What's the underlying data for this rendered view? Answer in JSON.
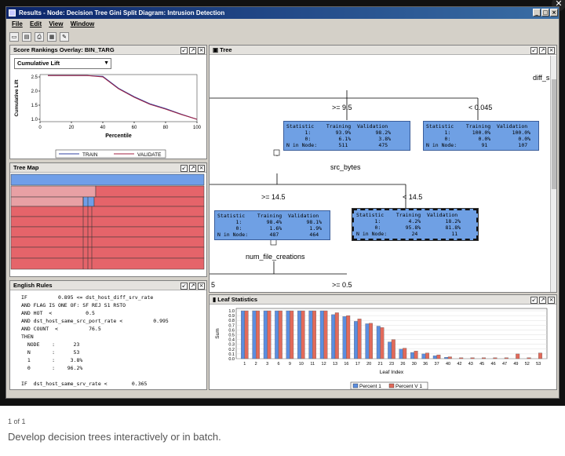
{
  "window": {
    "title": "Results - Node: Decision Tree Gini Split  Diagram: Intrusion Detection",
    "controls": [
      "_",
      "□",
      "×"
    ]
  },
  "menu": [
    "File",
    "Edit",
    "View",
    "Window"
  ],
  "score_panel": {
    "title": "Score Rankings Overlay: BIN_TARG",
    "dropdown": "Cumulative Lift",
    "legend_train": "TRAIN",
    "legend_validate": "VALIDATE"
  },
  "treemap_panel": {
    "title": "Tree Map"
  },
  "rules_panel": {
    "title": "English Rules",
    "text": "IF          0.895 <= dst_host_diff_srv_rate\nAND FLAG IS ONE OF: SF REJ S1 RSTO\nAND HOT  <           0.5\nAND dst_host_same_src_port_rate <          0.995\nAND COUNT  <          76.5\nTHEN\n  NODE    :      23\n  N       :      53\n  1       :     3.8%\n  0       :    96.2%\n\nIF  dst_host_same_srv_rate <        0.365"
  },
  "tree_panel": {
    "title": "Tree",
    "labels": {
      "diff": "diff_s",
      "ge95": ">=   9.5",
      "lt045": "<  0.045",
      "src": "src_bytes",
      "ge145": ">=  14.5",
      "lt145": "<   14.5",
      "num": "num_file_creations",
      "five": "5",
      "ge05": ">=   0.5"
    },
    "nodes": [
      "Statistic    Training  Validation\n      1:        93.9%        98.2%\n      0:         6.1%         3.8%\nN in Node:       511          475",
      "Statistic    Training  Validation\n      1:       100.0%       100.0%\n      0:         0.0%         0.0%\nN in Node:        91          107",
      "Statistic    Training  Validation\n      1:        98.4%        98.1%\n      0:         1.6%         1.9%\nN in Node:       487          464",
      "Statistic    Training  Validation\n      1:         4.2%        18.2%\n      0:        95.8%        81.8%\nN in Node:        24           11"
    ]
  },
  "leaf_panel": {
    "title": "Leaf Statistics"
  },
  "colors": {
    "title_bar": "#0a246a",
    "node_fill": "#6fa0e4",
    "bar_percent1": "#5b8ee0",
    "bar_percentv1": "#e26a5a",
    "treemap": "#e5646a"
  },
  "chart_data": [
    {
      "type": "line",
      "title": "",
      "xlabel": "Percentile",
      "ylabel": "Cumulative Lift",
      "x": [
        5,
        10,
        20,
        30,
        40,
        50,
        60,
        70,
        80,
        90,
        100
      ],
      "x_ticks": [
        "0",
        "20",
        "40",
        "60",
        "80",
        "100"
      ],
      "y_ticks": [
        "1.0",
        "1.5",
        "2.0",
        "2.5"
      ],
      "xlim": [
        0,
        100
      ],
      "ylim": [
        1.0,
        2.5
      ],
      "series": [
        {
          "name": "TRAIN",
          "color": "#3040a0",
          "values": [
            2.55,
            2.55,
            2.55,
            2.55,
            2.52,
            2.1,
            1.8,
            1.55,
            1.38,
            1.18,
            1.0
          ]
        },
        {
          "name": "VALIDATE",
          "color": "#a02040",
          "values": [
            2.55,
            2.55,
            2.55,
            2.55,
            2.5,
            2.08,
            1.78,
            1.53,
            1.36,
            1.17,
            1.0
          ]
        }
      ],
      "legend": "bottom"
    },
    {
      "type": "bar",
      "title": "",
      "xlabel": "Leaf Index",
      "ylabel": "Sum",
      "categories": [
        "1",
        "2",
        "3",
        "6",
        "9",
        "10",
        "11",
        "12",
        "13",
        "16",
        "17",
        "20",
        "21",
        "23",
        "26",
        "30",
        "36",
        "37",
        "40",
        "42",
        "43",
        "45",
        "46",
        "47",
        "49",
        "52",
        "53"
      ],
      "y_ticks": [
        "0.0",
        "0.1",
        "0.2",
        "0.3",
        "0.4",
        "0.5",
        "0.6",
        "0.7",
        "0.8",
        "0.9",
        "1.0"
      ],
      "ylim": [
        0,
        1.0
      ],
      "series": [
        {
          "name": "Percent 1",
          "color": "#5b8ee0",
          "values": [
            1.0,
            1.0,
            1.0,
            1.0,
            1.0,
            1.0,
            1.0,
            1.0,
            0.92,
            0.88,
            0.78,
            0.73,
            0.68,
            0.35,
            0.2,
            0.13,
            0.1,
            0.06,
            0.03,
            0.0,
            0.0,
            0.0,
            0.0,
            0.0,
            0.0,
            0.0,
            0.0
          ]
        },
        {
          "name": "Percent V 1",
          "color": "#e26a5a",
          "values": [
            1.0,
            1.0,
            1.0,
            1.0,
            1.0,
            1.0,
            1.0,
            1.0,
            0.96,
            0.9,
            0.83,
            0.74,
            0.65,
            0.4,
            0.22,
            0.16,
            0.12,
            0.08,
            0.04,
            0.02,
            0.02,
            0.02,
            0.02,
            0.02,
            0.1,
            0.02,
            0.12
          ]
        }
      ],
      "legend": "bottom"
    }
  ],
  "footer": {
    "pager": "1 of 1",
    "caption": "Develop decision trees interactively or in batch."
  }
}
